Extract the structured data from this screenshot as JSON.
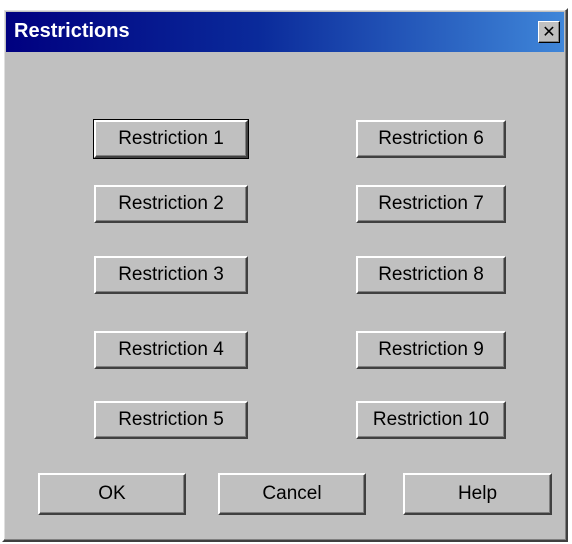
{
  "dialog": {
    "title": "Restrictions",
    "close_glyph": "✕"
  },
  "restrictions": {
    "left": [
      "Restriction 1",
      "Restriction 2",
      "Restriction 3",
      "Restriction 4",
      "Restriction 5"
    ],
    "right": [
      "Restriction 6",
      "Restriction 7",
      "Restriction 8",
      "Restriction 9",
      "Restriction 10"
    ]
  },
  "footer": {
    "ok_label": "OK",
    "cancel_label": "Cancel",
    "help_label": "Help"
  }
}
